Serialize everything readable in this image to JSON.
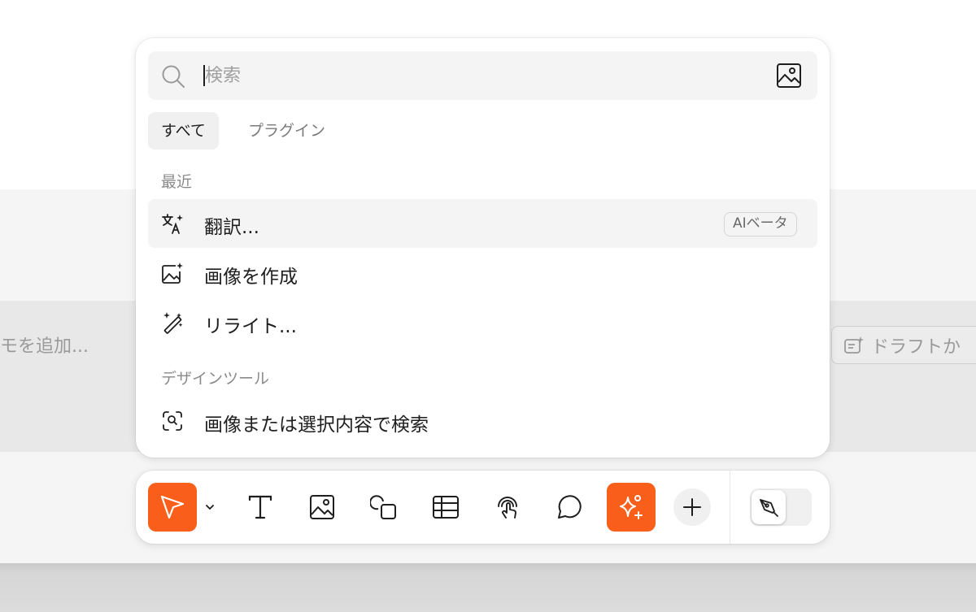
{
  "background": {
    "memo_text": "モを追加...",
    "draft_button_label": "ドラフトか"
  },
  "search": {
    "placeholder": "検索",
    "value": "",
    "search_icon": "search-icon",
    "image_search_icon": "image-icon"
  },
  "tabs": [
    {
      "label": "すべて",
      "selected": true
    },
    {
      "label": "プラグイン",
      "selected": false
    }
  ],
  "sections": {
    "recent": {
      "heading": "最近",
      "items": [
        {
          "label": "翻訳...",
          "icon": "translate-sparkle-icon",
          "badge": "AIベータ",
          "highlighted": true
        },
        {
          "label": "画像を作成",
          "icon": "image-sparkle-icon"
        },
        {
          "label": "リライト...",
          "icon": "magic-wand-icon"
        }
      ]
    },
    "design_tools": {
      "heading": "デザインツール",
      "items": [
        {
          "label": "画像または選択内容で検索",
          "icon": "visual-search-icon"
        }
      ]
    }
  },
  "toolbar": {
    "accent_color": "#f95f1b",
    "tools": [
      {
        "name": "move-tool",
        "icon": "cursor-arrow-icon",
        "active": true
      },
      {
        "name": "text-tool",
        "icon": "text-t-icon"
      },
      {
        "name": "image-tool",
        "icon": "image-icon"
      },
      {
        "name": "shape-tool",
        "icon": "shapes-icon"
      },
      {
        "name": "table-tool",
        "icon": "table-icon"
      },
      {
        "name": "interaction-tool",
        "icon": "tap-hand-icon"
      },
      {
        "name": "comment-tool",
        "icon": "comment-bubble-icon"
      },
      {
        "name": "ai-actions-tool",
        "icon": "ai-sparkle-icon",
        "active": true
      },
      {
        "name": "more-tools",
        "icon": "plus-icon"
      }
    ],
    "mode_toggle_icon": "pen-nib-icon"
  }
}
